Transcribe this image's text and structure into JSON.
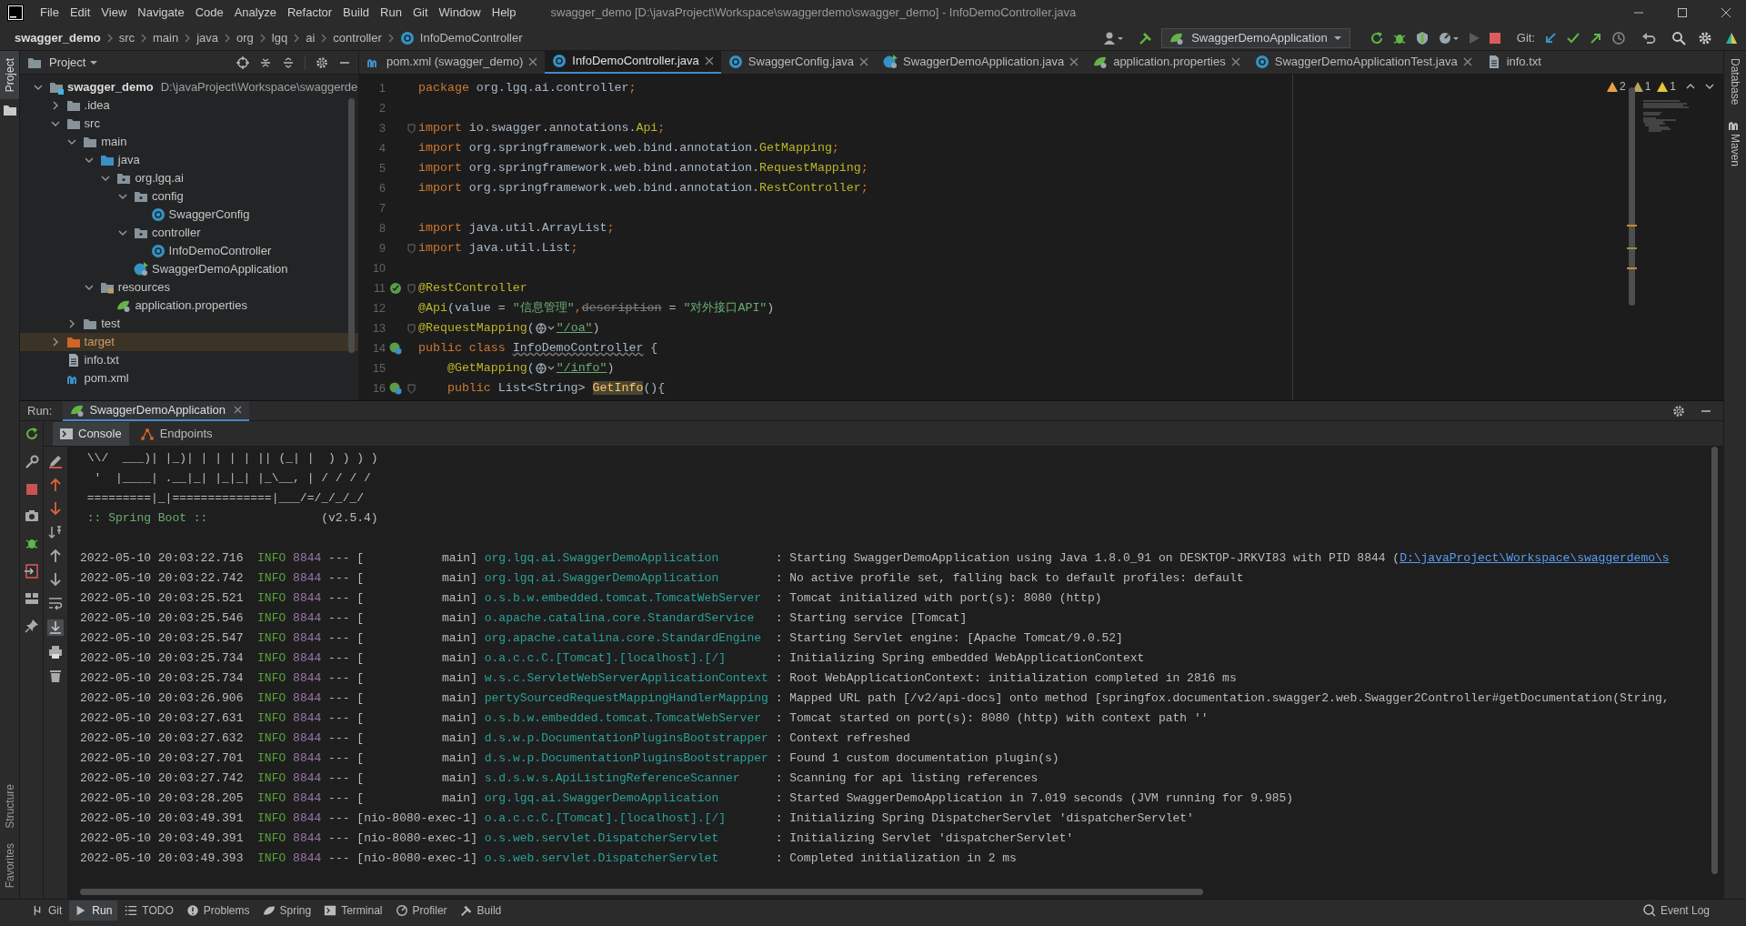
{
  "menu": [
    "File",
    "Edit",
    "View",
    "Navigate",
    "Code",
    "Analyze",
    "Refactor",
    "Build",
    "Run",
    "Git",
    "Window",
    "Help"
  ],
  "window_title": "swagger_demo [D:\\javaProject\\Workspace\\swaggerdemo\\swagger_demo] - InfoDemoController.java",
  "breadcrumbs": [
    "swagger_demo",
    "src",
    "main",
    "java",
    "org",
    "lgq",
    "ai",
    "controller",
    "InfoDemoController"
  ],
  "run_config": "SwaggerDemoApplication",
  "vcs_label": "Git:",
  "project_panel": {
    "title": "Project",
    "tree": [
      {
        "label": "swagger_demo",
        "path": "D:\\javaProject\\Workspace\\swaggerde",
        "kind": "module",
        "expanded": true,
        "selected": false,
        "children": [
          {
            "label": ".idea",
            "kind": "folder",
            "expanded": false,
            "selected": false
          },
          {
            "label": "src",
            "kind": "folder",
            "expanded": true,
            "selected": false,
            "children": [
              {
                "label": "main",
                "kind": "folder",
                "expanded": true,
                "selected": false,
                "children": [
                  {
                    "label": "java",
                    "kind": "source-root",
                    "expanded": true,
                    "selected": false,
                    "children": [
                      {
                        "label": "org.lgq.ai",
                        "kind": "package",
                        "expanded": true,
                        "selected": false,
                        "children": [
                          {
                            "label": "config",
                            "kind": "package",
                            "expanded": true,
                            "selected": false,
                            "children": [
                              {
                                "label": "SwaggerConfig",
                                "kind": "class",
                                "selected": false
                              }
                            ]
                          },
                          {
                            "label": "controller",
                            "kind": "package",
                            "expanded": true,
                            "selected": false,
                            "children": [
                              {
                                "label": "InfoDemoController",
                                "kind": "class",
                                "selected": false
                              }
                            ]
                          },
                          {
                            "label": "SwaggerDemoApplication",
                            "kind": "spring-app",
                            "selected": false
                          }
                        ]
                      }
                    ]
                  },
                  {
                    "label": "resources",
                    "kind": "resources",
                    "expanded": true,
                    "selected": false,
                    "children": [
                      {
                        "label": "application.properties",
                        "kind": "properties",
                        "selected": false
                      }
                    ]
                  }
                ]
              },
              {
                "label": "test",
                "kind": "folder",
                "expanded": false,
                "selected": false
              }
            ]
          },
          {
            "label": "target",
            "kind": "excluded",
            "expanded": false,
            "selected": true
          },
          {
            "label": "info.txt",
            "kind": "text",
            "selected": false
          },
          {
            "label": "pom.xml",
            "kind": "maven",
            "selected": false
          }
        ]
      }
    ]
  },
  "editor_tabs": [
    {
      "label": "pom.xml (swagger_demo)",
      "kind": "maven",
      "selected": false,
      "closable": true
    },
    {
      "label": "InfoDemoController.java",
      "kind": "class",
      "selected": true,
      "closable": true
    },
    {
      "label": "SwaggerConfig.java",
      "kind": "class",
      "selected": false,
      "closable": true
    },
    {
      "label": "SwaggerDemoApplication.java",
      "kind": "spring-app",
      "selected": false,
      "closable": true
    },
    {
      "label": "application.properties",
      "kind": "properties",
      "selected": false,
      "closable": true
    },
    {
      "label": "SwaggerDemoApplicationTest.java",
      "kind": "class",
      "selected": false,
      "closable": true
    },
    {
      "label": "info.txt",
      "kind": "text",
      "selected": false,
      "closable": false
    }
  ],
  "inspections": [
    {
      "count": "2",
      "color": "#e8a33d"
    },
    {
      "count": "1",
      "color": "#b8a65a"
    },
    {
      "count": "1",
      "color": "#e8c33d"
    }
  ],
  "code_lines": [
    {
      "number": "1",
      "fold": false,
      "segments": [
        {
          "text": "package",
          "kind": "keyword"
        },
        {
          "text": " org.lgq.ai.controller",
          "kind": "plain"
        },
        {
          "text": ";",
          "kind": "punct"
        }
      ]
    },
    {
      "number": "2",
      "fold": false
    },
    {
      "number": "3",
      "fold": true,
      "segments": [
        {
          "text": "import",
          "kind": "keyword"
        },
        {
          "text": " io.swagger.annotations.",
          "kind": "plain"
        },
        {
          "text": "Api",
          "kind": "annotation"
        },
        {
          "text": ";",
          "kind": "punct"
        }
      ]
    },
    {
      "number": "4",
      "fold": false,
      "segments": [
        {
          "text": "import",
          "kind": "keyword"
        },
        {
          "text": " org.springframework.web.bind.annotation.",
          "kind": "plain"
        },
        {
          "text": "GetMapping",
          "kind": "annotation"
        },
        {
          "text": ";",
          "kind": "punct"
        }
      ]
    },
    {
      "number": "5",
      "fold": false,
      "segments": [
        {
          "text": "import",
          "kind": "keyword"
        },
        {
          "text": " org.springframework.web.bind.annotation.",
          "kind": "plain"
        },
        {
          "text": "RequestMapping",
          "kind": "annotation"
        },
        {
          "text": ";",
          "kind": "punct"
        }
      ]
    },
    {
      "number": "6",
      "fold": false,
      "segments": [
        {
          "text": "import",
          "kind": "keyword"
        },
        {
          "text": " org.springframework.web.bind.annotation.",
          "kind": "plain"
        },
        {
          "text": "RestController",
          "kind": "annotation"
        },
        {
          "text": ";",
          "kind": "punct"
        }
      ]
    },
    {
      "number": "7",
      "fold": false
    },
    {
      "number": "8",
      "fold": false,
      "segments": [
        {
          "text": "import",
          "kind": "keyword"
        },
        {
          "text": " java.util.ArrayList",
          "kind": "plain"
        },
        {
          "text": ";",
          "kind": "punct"
        }
      ]
    },
    {
      "number": "9",
      "fold": true,
      "segments": [
        {
          "text": "import",
          "kind": "keyword"
        },
        {
          "text": " java.util.List",
          "kind": "plain"
        },
        {
          "text": ";",
          "kind": "punct"
        }
      ]
    },
    {
      "number": "10",
      "fold": false
    },
    {
      "number": "11",
      "fold": true,
      "gutter": {
        "kind": "bean"
      },
      "segments": [
        {
          "text": "@RestController",
          "kind": "annotation"
        }
      ]
    },
    {
      "number": "12",
      "fold": false,
      "segments": [
        {
          "text": "@Api",
          "kind": "annotation"
        },
        {
          "text": "(value = ",
          "kind": "plain"
        },
        {
          "text": "\"信息管理\"",
          "kind": "string"
        },
        {
          "text": ",",
          "kind": "punct"
        },
        {
          "text": "description",
          "kind": "deprecated"
        },
        {
          "text": " = ",
          "kind": "plain"
        },
        {
          "text": "\"对外接口API\"",
          "kind": "string"
        },
        {
          "text": ")",
          "kind": "plain"
        }
      ]
    },
    {
      "number": "13",
      "fold": true,
      "segments": [
        {
          "text": "@RequestMapping",
          "kind": "annotation"
        },
        {
          "text": "(",
          "kind": "plain"
        },
        {
          "kind": "url-icon"
        },
        {
          "text": "\"/oa\"",
          "kind": "url-string"
        },
        {
          "text": ")",
          "kind": "plain"
        }
      ]
    },
    {
      "number": "14",
      "fold": false,
      "gutter": {
        "kind": "web-bean"
      },
      "segments": [
        {
          "text": "public class ",
          "kind": "keyword"
        },
        {
          "text": "InfoDemoController",
          "kind": "class-decl"
        },
        {
          "text": " {",
          "kind": "plain"
        }
      ]
    },
    {
      "number": "15",
      "fold": false,
      "segments": [
        {
          "text": "    @GetMapping",
          "kind": "annotation"
        },
        {
          "text": "(",
          "kind": "plain"
        },
        {
          "kind": "url-icon"
        },
        {
          "text": "\"/info\"",
          "kind": "url-string"
        },
        {
          "text": ")",
          "kind": "plain"
        }
      ]
    },
    {
      "number": "16",
      "fold": true,
      "gutter": {
        "kind": "web-bean"
      },
      "segments": [
        {
          "text": "    public",
          "kind": "keyword"
        },
        {
          "text": " List<String> ",
          "kind": "plain"
        },
        {
          "text": "GetInfo",
          "kind": "method-decl"
        },
        {
          "text": "(){",
          "kind": "plain"
        }
      ]
    }
  ],
  "run_panel": {
    "label": "Run:",
    "tab": "SwaggerDemoApplication",
    "subtabs": [
      {
        "label": "Console",
        "kind": "console",
        "selected": true
      },
      {
        "label": "Endpoints",
        "kind": "endpoints",
        "selected": false
      }
    ]
  },
  "console_banner": [
    " \\\\/  ___)| |_)| | | | | || (_| |  ) ) ) )",
    "  '  |____| .__|_| |_|_| |_\\__, | / / / /",
    " =========|_|==============|___/=/_/_/_/"
  ],
  "spring_boot_line": {
    "label": " :: Spring Boot ::",
    "version": "(v2.5.4)"
  },
  "log_entries": [
    {
      "time": "2022-05-10 20:03:22.716",
      "level": "INFO",
      "pid": "8844",
      "separator": "---",
      "thread": "[           main]",
      "logger": "org.lgq.ai.SwaggerDemoApplication",
      "message": ": Starting SwaggerDemoApplication using Java 1.8.0_91 on DESKTOP-JRKVI83 with PID 8844 (",
      "link": "D:\\javaProject\\Workspace\\swaggerdemo\\s"
    },
    {
      "time": "2022-05-10 20:03:22.742",
      "level": "INFO",
      "pid": "8844",
      "separator": "---",
      "thread": "[           main]",
      "logger": "org.lgq.ai.SwaggerDemoApplication",
      "message": ": No active profile set, falling back to default profiles: default"
    },
    {
      "time": "2022-05-10 20:03:25.521",
      "level": "INFO",
      "pid": "8844",
      "separator": "---",
      "thread": "[           main]",
      "logger": "o.s.b.w.embedded.tomcat.TomcatWebServer",
      "message": ": Tomcat initialized with port(s): 8080 (http)"
    },
    {
      "time": "2022-05-10 20:03:25.546",
      "level": "INFO",
      "pid": "8844",
      "separator": "---",
      "thread": "[           main]",
      "logger": "o.apache.catalina.core.StandardService",
      "message": ": Starting service [Tomcat]"
    },
    {
      "time": "2022-05-10 20:03:25.547",
      "level": "INFO",
      "pid": "8844",
      "separator": "---",
      "thread": "[           main]",
      "logger": "org.apache.catalina.core.StandardEngine",
      "message": ": Starting Servlet engine: [Apache Tomcat/9.0.52]"
    },
    {
      "time": "2022-05-10 20:03:25.734",
      "level": "INFO",
      "pid": "8844",
      "separator": "---",
      "thread": "[           main]",
      "logger": "o.a.c.c.C.[Tomcat].[localhost].[/]",
      "message": ": Initializing Spring embedded WebApplicationContext"
    },
    {
      "time": "2022-05-10 20:03:25.734",
      "level": "INFO",
      "pid": "8844",
      "separator": "---",
      "thread": "[           main]",
      "logger": "w.s.c.ServletWebServerApplicationContext",
      "message": ": Root WebApplicationContext: initialization completed in 2816 ms"
    },
    {
      "time": "2022-05-10 20:03:26.906",
      "level": "INFO",
      "pid": "8844",
      "separator": "---",
      "thread": "[           main]",
      "logger": "pertySourcedRequestMappingHandlerMapping",
      "message": ": Mapped URL path [/v2/api-docs] onto method [springfox.documentation.swagger2.web.Swagger2Controller#getDocumentation(String,"
    },
    {
      "time": "2022-05-10 20:03:27.631",
      "level": "INFO",
      "pid": "8844",
      "separator": "---",
      "thread": "[           main]",
      "logger": "o.s.b.w.embedded.tomcat.TomcatWebServer",
      "message": ": Tomcat started on port(s): 8080 (http) with context path ''"
    },
    {
      "time": "2022-05-10 20:03:27.632",
      "level": "INFO",
      "pid": "8844",
      "separator": "---",
      "thread": "[           main]",
      "logger": "d.s.w.p.DocumentationPluginsBootstrapper",
      "message": ": Context refreshed"
    },
    {
      "time": "2022-05-10 20:03:27.701",
      "level": "INFO",
      "pid": "8844",
      "separator": "---",
      "thread": "[           main]",
      "logger": "d.s.w.p.DocumentationPluginsBootstrapper",
      "message": ": Found 1 custom documentation plugin(s)"
    },
    {
      "time": "2022-05-10 20:03:27.742",
      "level": "INFO",
      "pid": "8844",
      "separator": "---",
      "thread": "[           main]",
      "logger": "s.d.s.w.s.ApiListingReferenceScanner",
      "message": ": Scanning for api listing references"
    },
    {
      "time": "2022-05-10 20:03:28.205",
      "level": "INFO",
      "pid": "8844",
      "separator": "---",
      "thread": "[           main]",
      "logger": "org.lgq.ai.SwaggerDemoApplication",
      "message": ": Started SwaggerDemoApplication in 7.019 seconds (JVM running for 9.985)"
    },
    {
      "time": "2022-05-10 20:03:49.391",
      "level": "INFO",
      "pid": "8844",
      "separator": "---",
      "thread": "[nio-8080-exec-1]",
      "logger": "o.a.c.c.C.[Tomcat].[localhost].[/]",
      "message": ": Initializing Spring DispatcherServlet 'dispatcherServlet'"
    },
    {
      "time": "2022-05-10 20:03:49.391",
      "level": "INFO",
      "pid": "8844",
      "separator": "---",
      "thread": "[nio-8080-exec-1]",
      "logger": "o.s.web.servlet.DispatcherServlet",
      "message": ": Initializing Servlet 'dispatcherServlet'"
    },
    {
      "time": "2022-05-10 20:03:49.393",
      "level": "INFO",
      "pid": "8844",
      "separator": "---",
      "thread": "[nio-8080-exec-1]",
      "logger": "o.s.web.servlet.DispatcherServlet",
      "message": ": Completed initialization in 2 ms"
    }
  ],
  "left_strip": {
    "top": [
      {
        "label": "Project",
        "selected": true
      }
    ],
    "bottom": [
      {
        "label": "Structure",
        "selected": false
      },
      {
        "label": "Favorites",
        "selected": false
      }
    ]
  },
  "right_strip": [
    {
      "label": "Database",
      "kind": "database"
    },
    {
      "label": "Maven",
      "kind": "maven"
    }
  ],
  "bottom_tools": [
    {
      "label": "Git",
      "kind": "git",
      "selected": false
    },
    {
      "label": "Run",
      "kind": "run",
      "selected": true
    },
    {
      "label": "TODO",
      "kind": "todo",
      "selected": false
    },
    {
      "label": "Problems",
      "kind": "problems",
      "selected": false
    },
    {
      "label": "Spring",
      "kind": "spring",
      "selected": false
    },
    {
      "label": "Terminal",
      "kind": "terminal",
      "selected": false
    },
    {
      "label": "Profiler",
      "kind": "profiler",
      "selected": false
    },
    {
      "label": "Build",
      "kind": "build",
      "selected": false
    }
  ],
  "event_log": "Event Log"
}
